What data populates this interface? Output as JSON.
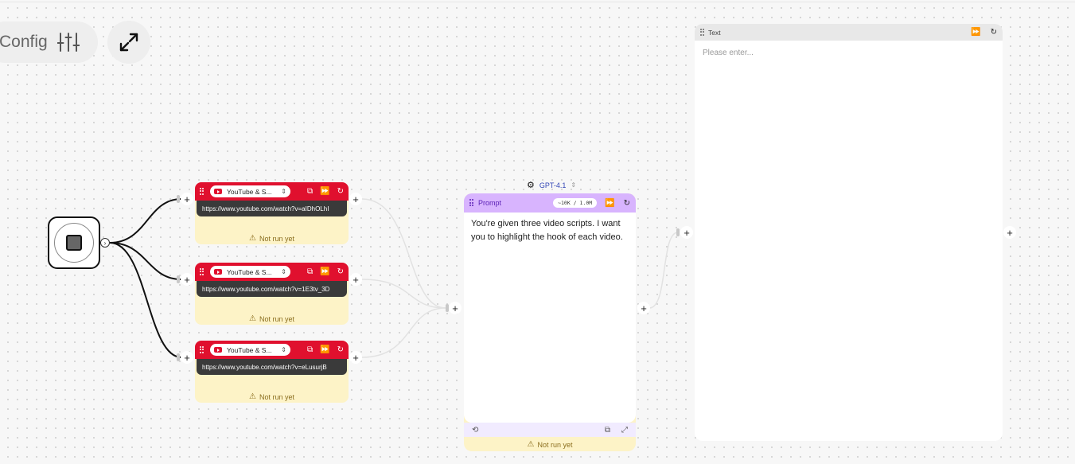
{
  "toolbar": {
    "config_label": "Config",
    "config_icon": "sliders-icon",
    "expand_icon": "expand-arrows-icon"
  },
  "youtube_nodes": [
    {
      "label": "YouTube & S...",
      "url": "https://www.youtube.com/watch?v=aIDhOLhI",
      "status": "Not run yet"
    },
    {
      "label": "YouTube & S...",
      "url": "https://www.youtube.com/watch?v=1E3tv_3D",
      "status": "Not run yet"
    },
    {
      "label": "YouTube & S...",
      "url": "https://www.youtube.com/watch?v=eLusurjB",
      "status": "Not run yet"
    }
  ],
  "prompt_node": {
    "model": "GPT-4.1",
    "title": "Prompt",
    "tokens": "~10K / 1.0M",
    "text": "You're given three video scripts. I want you to highlight the hook of each video.",
    "status": "Not run yet"
  },
  "text_node": {
    "title": "Text",
    "placeholder": "Please enter..."
  },
  "colors": {
    "youtube_red": "#e0102e",
    "prompt_purple": "#d8b4fe",
    "status_yellow": "#fdf3c7",
    "model_blue": "#3346b5"
  }
}
